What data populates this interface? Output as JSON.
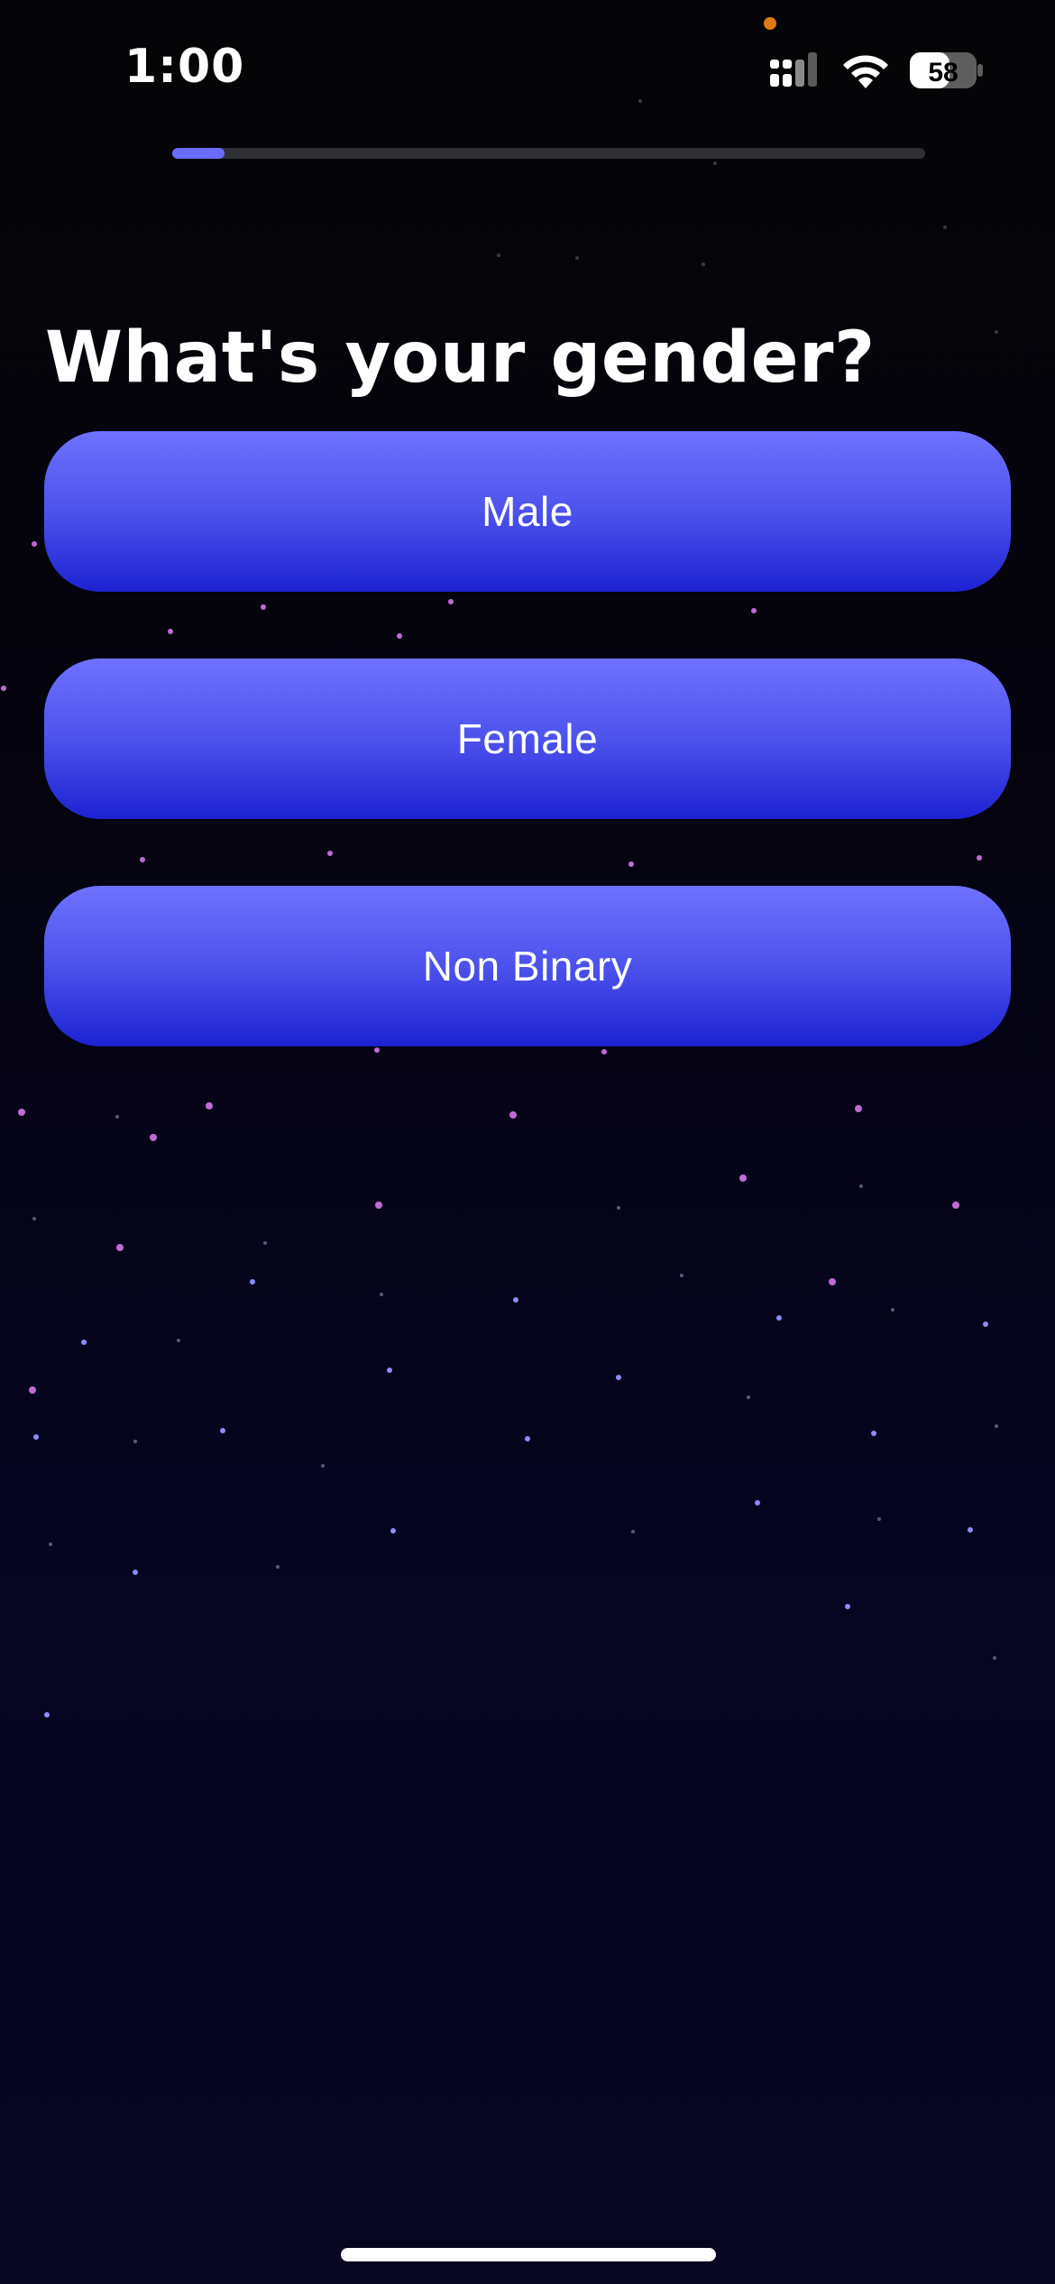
{
  "status_bar": {
    "time": "1:00",
    "battery": "58"
  },
  "progress": {
    "fraction": 0.07
  },
  "title": "What's your gender?",
  "options": [
    {
      "label": "Male"
    },
    {
      "label": "Female"
    },
    {
      "label": "Non Binary"
    }
  ],
  "icons": {
    "signal": "cellular-signal-icon",
    "wifi": "wifi-icon",
    "battery": "battery-icon"
  },
  "colors": {
    "accent": "#6a6cff",
    "button_top": "#6f72fe",
    "button_bottom": "#1c22d2",
    "background": "#05040f"
  }
}
